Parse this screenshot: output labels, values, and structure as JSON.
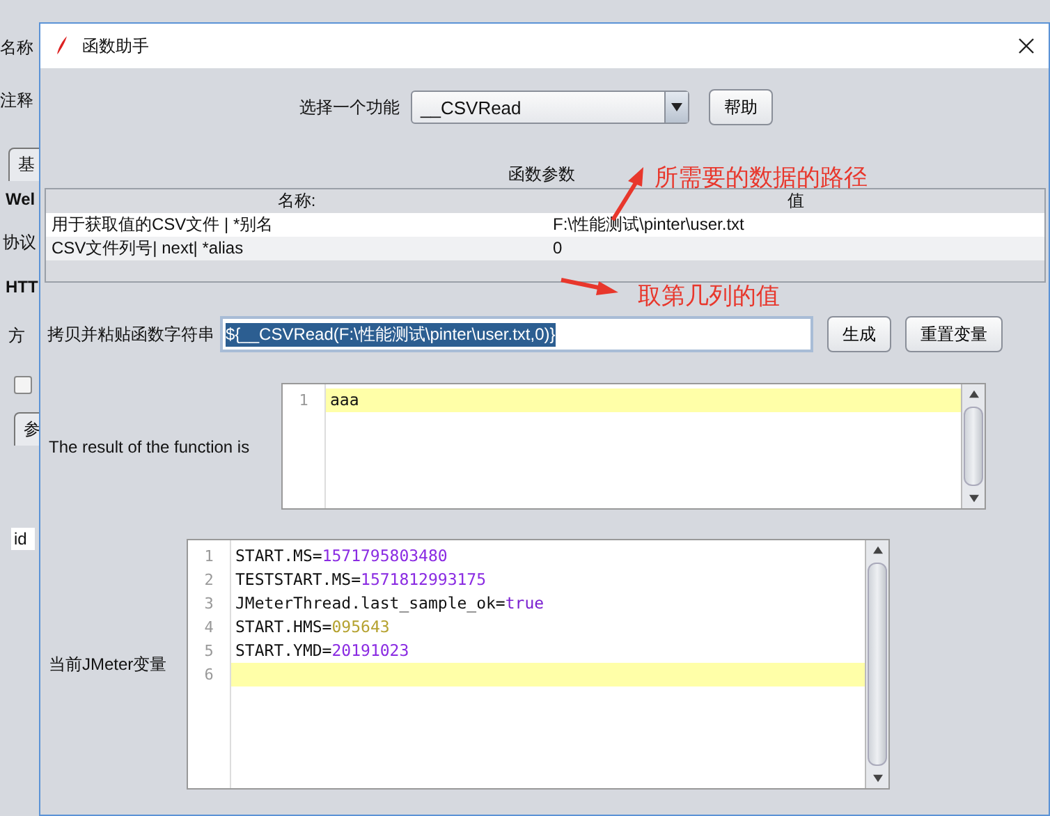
{
  "background_window": {
    "items": [
      {
        "kind": "label",
        "text": "名称"
      },
      {
        "kind": "label",
        "text": "注释"
      },
      {
        "kind": "tab",
        "text": "基"
      },
      {
        "kind": "heading",
        "text": "Wel"
      },
      {
        "kind": "label",
        "text": "协议"
      },
      {
        "kind": "heading",
        "text": "HTT"
      },
      {
        "kind": "label",
        "text": "方"
      },
      {
        "kind": "checkbox",
        "checked": false
      },
      {
        "kind": "tab",
        "text": "参"
      },
      {
        "kind": "column",
        "text": "id"
      }
    ]
  },
  "dialog": {
    "title": "函数助手",
    "function_label": "选择一个功能",
    "function_value": "__CSVRead",
    "help_button": "帮助",
    "params_title": "函数参数",
    "params_table": {
      "columns": [
        "名称:",
        "值"
      ],
      "rows": [
        {
          "name": "用于获取值的CSV文件 | *别名",
          "value": "F:\\性能测试\\pinter\\user.txt"
        },
        {
          "name": "CSV文件列号| next| *alias",
          "value": "0"
        }
      ]
    },
    "copy_label": "拷贝并粘贴函数字符串",
    "copy_value": "${__CSVRead(F:\\性能测试\\pinter\\user.txt,0)}",
    "copy_value_selected": true,
    "generate_button": "生成",
    "reset_button": "重置变量",
    "result_label": "The result of the function is",
    "result_lines": [
      {
        "number": "1",
        "text": "aaa",
        "current": true
      }
    ],
    "variables_label": "当前JMeter变量",
    "variable_lines": [
      {
        "number": "1",
        "key": "START.MS=",
        "value": "1571795803480",
        "color": "#8a2be2",
        "current": false
      },
      {
        "number": "2",
        "key": "TESTSTART.MS=",
        "value": "1571812993175",
        "color": "#8a2be2",
        "current": false
      },
      {
        "number": "3",
        "key": "JMeterThread.last_sample_ok=",
        "value": "true",
        "color": "#7a1fd0",
        "current": false
      },
      {
        "number": "4",
        "key": "START.HMS=",
        "value": "095643",
        "color": "#b5a230",
        "current": false
      },
      {
        "number": "5",
        "key": "START.YMD=",
        "value": "20191023",
        "color": "#8a2be2",
        "current": false
      },
      {
        "number": "6",
        "current": true
      }
    ]
  },
  "annotations": [
    {
      "text": "所需要的数据的路径"
    },
    {
      "text": "取第几列的值"
    }
  ]
}
